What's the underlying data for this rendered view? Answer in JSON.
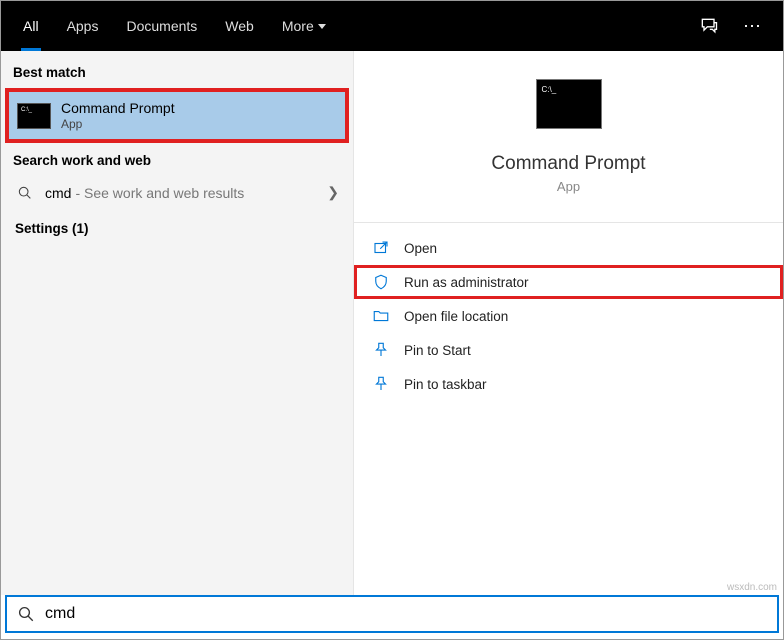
{
  "tabs": {
    "all": "All",
    "apps": "Apps",
    "documents": "Documents",
    "web": "Web",
    "more": "More"
  },
  "left": {
    "best_match_label": "Best match",
    "best_match": {
      "title": "Command Prompt",
      "sub": "App"
    },
    "search_section": "Search work and web",
    "web_term": "cmd",
    "web_hint": " - See work and web results",
    "settings": "Settings (1)"
  },
  "right": {
    "title": "Command Prompt",
    "sub": "App",
    "actions": {
      "open": "Open",
      "run_admin": "Run as administrator",
      "open_loc": "Open file location",
      "pin_start": "Pin to Start",
      "pin_taskbar": "Pin to taskbar"
    }
  },
  "search_value": "cmd",
  "watermark": "wsxdn.com"
}
